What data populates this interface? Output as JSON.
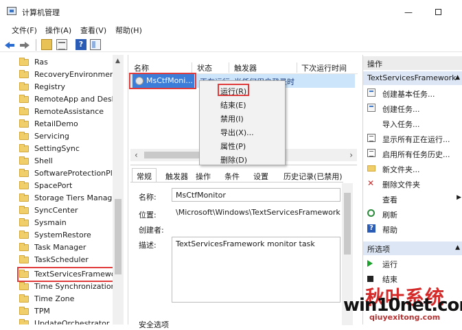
{
  "window": {
    "title": "计算机管理",
    "min_glyph": "—"
  },
  "menubar": [
    "文件(F)",
    "操作(A)",
    "查看(V)",
    "帮助(H)"
  ],
  "tree": {
    "items": [
      "Ras",
      "RecoveryEnvironment",
      "Registry",
      "RemoteApp and Desktop",
      "RemoteAssistance",
      "RetailDemo",
      "Servicing",
      "SettingSync",
      "Shell",
      "SoftwareProtectionPlatform",
      "SpacePort",
      "Storage Tiers Management",
      "SyncCenter",
      "Sysmain",
      "SystemRestore",
      "Task Manager",
      "TaskScheduler",
      "TextServicesFramework",
      "Time Synchronization",
      "Time Zone",
      "TPM",
      "UpdateOrchestrator"
    ],
    "selected": "TextServicesFramework"
  },
  "tasks": {
    "columns": [
      "名称",
      "状态",
      "触发器",
      "下次运行时间"
    ],
    "row": {
      "name": "MsCtfMoni...",
      "status": "正在运行",
      "trigger": "当任何用户登录时"
    }
  },
  "context_menu": [
    "运行(R)",
    "结束(E)",
    "禁用(I)",
    "导出(X)...",
    "属性(P)",
    "删除(D)"
  ],
  "detail": {
    "tabs": [
      "常规",
      "触发器",
      "操作",
      "条件",
      "设置",
      "历史记录(已禁用)"
    ],
    "name_label": "名称:",
    "name_value": "MsCtfMonitor",
    "location_label": "位置:",
    "location_value": "\\Microsoft\\Windows\\TextServicesFramework",
    "author_label": "创建者:",
    "desc_label": "描述:",
    "desc_value": "TextServicesFramework monitor task",
    "security_label": "安全选项"
  },
  "actions": {
    "header": "操作",
    "group1": "TextServicesFramework",
    "items1": [
      "创建基本任务...",
      "创建任务...",
      "导入任务...",
      "显示所有正在运行...",
      "启用所有任务历史...",
      "新文件夹...",
      "删除文件夹",
      "查看",
      "刷新",
      "帮助"
    ],
    "header2": "所选项",
    "items2": [
      "运行",
      "结束"
    ]
  },
  "watermark": {
    "cn": "秋叶系统",
    "en": "win10net.com",
    "sub": "qiuyexitong.com"
  },
  "colors": {
    "selection": "#3b7dd8",
    "highlight_border": "#e03a3a"
  }
}
